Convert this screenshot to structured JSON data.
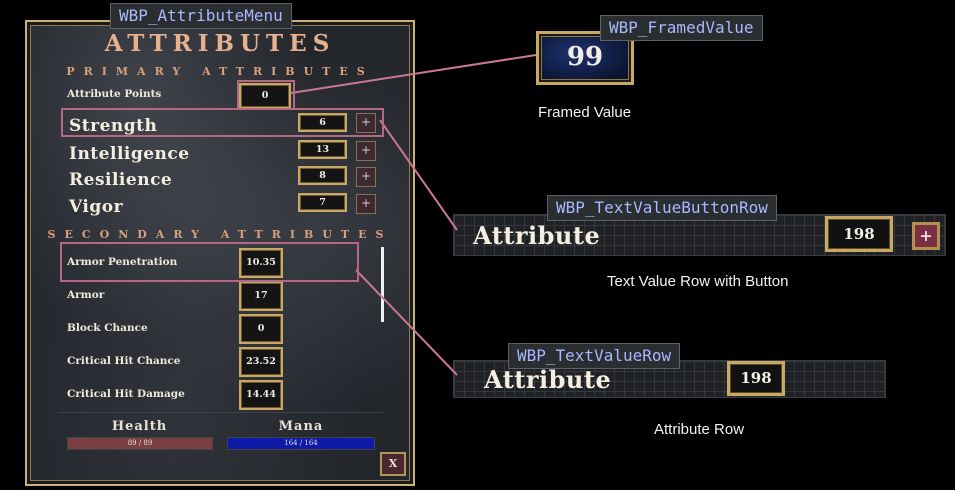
{
  "tags": {
    "menu": "WBP_AttributeMenu",
    "framed": "WBP_FramedValue",
    "button_row": "WBP_TextValueButtonRow",
    "value_row": "WBP_TextValueRow"
  },
  "menu": {
    "title": "ATTRIBUTES",
    "primary_header": "PRIMARY ATTRIBUTES",
    "attribute_points_label": "Attribute Points",
    "attribute_points_value": "0",
    "primary": [
      {
        "label": "Strength",
        "value": "6",
        "button": "+"
      },
      {
        "label": "Intelligence",
        "value": "13",
        "button": "+"
      },
      {
        "label": "Resilience",
        "value": "8",
        "button": "+"
      },
      {
        "label": "Vigor",
        "value": "7",
        "button": "+"
      }
    ],
    "secondary_header": "SECONDARY ATTRIBUTES",
    "secondary": [
      {
        "label": "Armor Penetration",
        "value": "10.35"
      },
      {
        "label": "Armor",
        "value": "17"
      },
      {
        "label": "Block Chance",
        "value": "0"
      },
      {
        "label": "Critical Hit Chance",
        "value": "23.52"
      },
      {
        "label": "Critical Hit Damage",
        "value": "14.44"
      }
    ],
    "health_label": "Health",
    "health_text": "89 / 89",
    "mana_label": "Mana",
    "mana_text": "164 / 164",
    "close_label": "X"
  },
  "framed_value": {
    "value": "99",
    "caption": "Framed Value"
  },
  "button_row": {
    "label": "Attribute",
    "value": "198",
    "button": "+",
    "caption": "Text Value Row with Button"
  },
  "value_row": {
    "label": "Attribute",
    "value": "198",
    "caption": "Attribute Row"
  },
  "colors": {
    "health": "#7a3e45",
    "mana": "#0e1aa8",
    "highlight": "#b56881",
    "frame": "#c9a765"
  }
}
